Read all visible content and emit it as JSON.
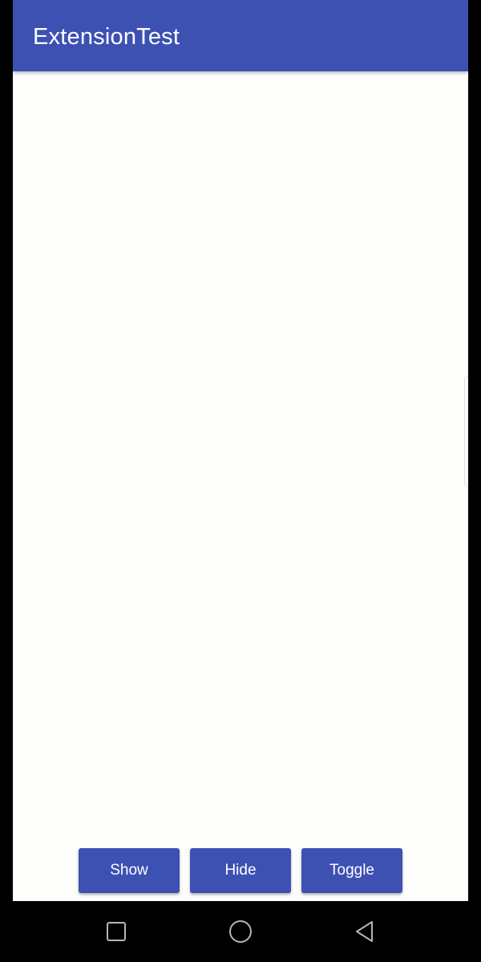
{
  "app_bar": {
    "title": "ExtensionTest",
    "color": "#3d51b3"
  },
  "buttons": {
    "show_label": "Show",
    "hide_label": "Hide",
    "toggle_label": "Toggle",
    "color": "#3d51b3"
  },
  "nav": {
    "recent_icon": "square-icon",
    "home_icon": "circle-icon",
    "back_icon": "triangle-back-icon"
  }
}
